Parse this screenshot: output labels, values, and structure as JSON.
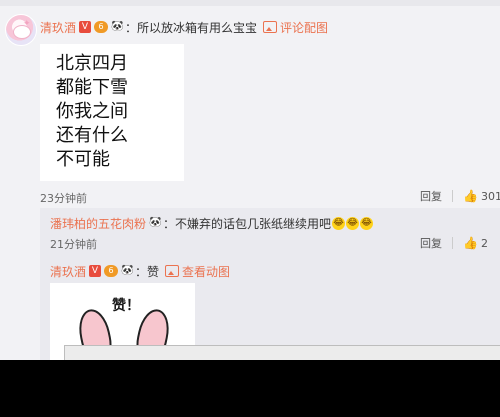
{
  "comment": {
    "username": "清玖酒",
    "text": "所以放冰箱有用么宝宝",
    "view_pic": "评论配图",
    "image_lines": [
      "北京四月",
      "都能下雪",
      "你我之间",
      "还有什么",
      "不可能"
    ],
    "time": "23分钟前",
    "reply_label": "回复",
    "likes": "301"
  },
  "reply1": {
    "username": "潘玮柏的五花肉粉",
    "text": "不嫌弃的话包几张纸继续用吧",
    "time": "21分钟前",
    "reply_label": "回复",
    "likes": "2"
  },
  "reply2": {
    "username": "清玖酒",
    "text": "赞",
    "view_pic": "查看动图",
    "sticker_text": "赞！"
  },
  "badges": {
    "v": "V",
    "level": "6",
    "panda": "🐼"
  },
  "colors": {
    "accent": "#eb7350",
    "bg": "#f2f2f5",
    "reply_bg": "#eaeaef"
  }
}
